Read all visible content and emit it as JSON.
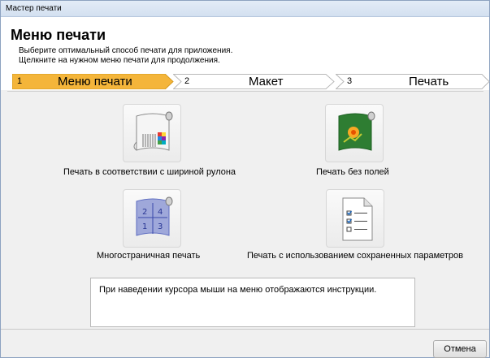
{
  "window": {
    "title": "Мастер печати"
  },
  "header": {
    "title": "Меню печати",
    "desc_line1": "Выберите оптимальный способ печати для приложения.",
    "desc_line2": "Щелкните на нужном меню печати для продолжения."
  },
  "steps": [
    {
      "num": "1",
      "label": "Меню печати",
      "active": true
    },
    {
      "num": "2",
      "label": "Макет",
      "active": false
    },
    {
      "num": "3",
      "label": "Печать",
      "active": false
    }
  ],
  "options": [
    {
      "label": "Печать в соответствии с шириной рулона",
      "icon": "roll-width-icon"
    },
    {
      "label": "Печать без полей",
      "icon": "borderless-icon"
    },
    {
      "label": "Многостраничная печать",
      "icon": "multipage-icon"
    },
    {
      "label": "Печать с использованием сохраненных параметров",
      "icon": "saved-settings-icon"
    }
  ],
  "hint": {
    "text": "При наведении курсора мыши на меню отображаются инструкции."
  },
  "footer": {
    "cancel_label": "Отмена"
  },
  "colors": {
    "active_step": "#f4b53a",
    "inactive_step": "#ffffff",
    "accent_green": "#2e7d32"
  }
}
